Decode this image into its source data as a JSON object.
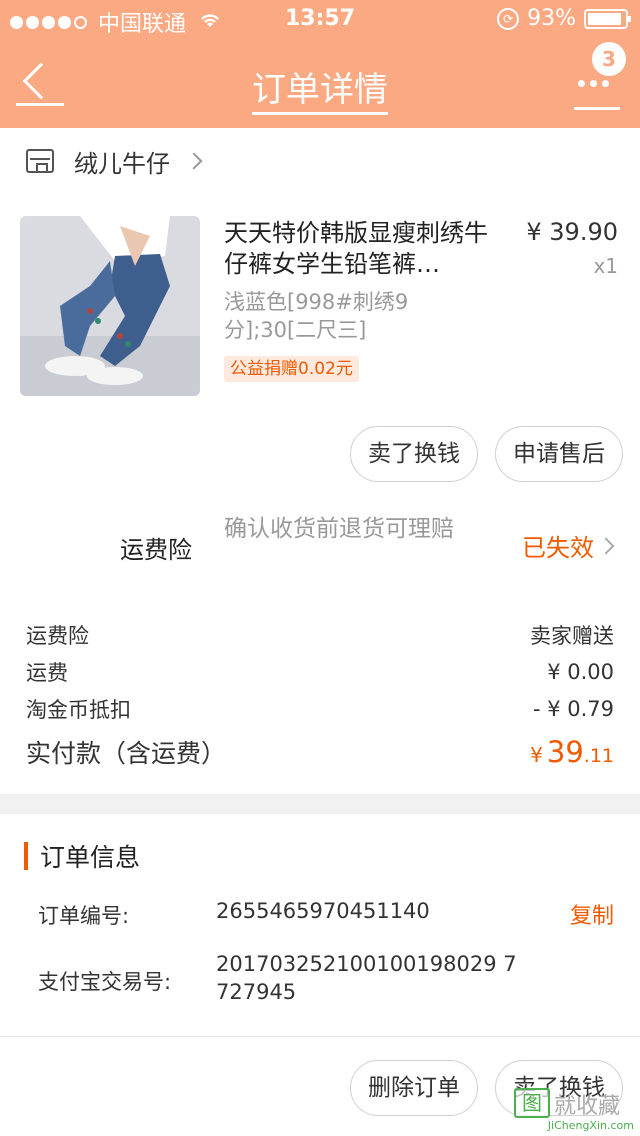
{
  "status_bar": {
    "carrier": "中国联通",
    "time": "13:57",
    "battery": "93%"
  },
  "nav": {
    "title": "订单详情",
    "badge_count": "3"
  },
  "shop": {
    "name": "绒儿牛仔"
  },
  "item": {
    "title": "天天特价韩版显瘦刺绣牛仔裤女学生铅笔裤…",
    "price": "¥ 39.90",
    "quantity": "x1",
    "sku": "浅蓝色[998#刺绣9分];30[二尺三]",
    "donation": "公益捐赠0.02元"
  },
  "item_actions": {
    "sell_exchange": "卖了换钱",
    "after_sale": "申请售后"
  },
  "insurance": {
    "label": "运费险",
    "description": "确认收货前退货可理赔",
    "status": "已失效"
  },
  "fees": [
    {
      "label": "运费险",
      "value": "卖家赠送"
    },
    {
      "label": "运费",
      "value": "¥ 0.00"
    },
    {
      "label": "淘金币抵扣",
      "value": "- ¥ 0.79"
    }
  ],
  "total": {
    "label": "实付款（含运费）",
    "currency": "¥",
    "integer": "39",
    "decimal": ".11"
  },
  "order_info": {
    "title": "订单信息",
    "order_no_label": "订单编号:",
    "order_no": "2655465970451140",
    "copy_label": "复制",
    "alipay_label": "支付宝交易号:",
    "alipay_no_line1": "201703252100100198029 7",
    "alipay_no_line2": "727945"
  },
  "bottom_actions": {
    "delete_order": "删除订单",
    "sell_exchange": "卖了换钱"
  },
  "watermark": {
    "logo": "图",
    "text": "就收藏",
    "url": "JiChengXin.com"
  },
  "colors": {
    "header": "#fba983",
    "accent": "#f25a00"
  }
}
